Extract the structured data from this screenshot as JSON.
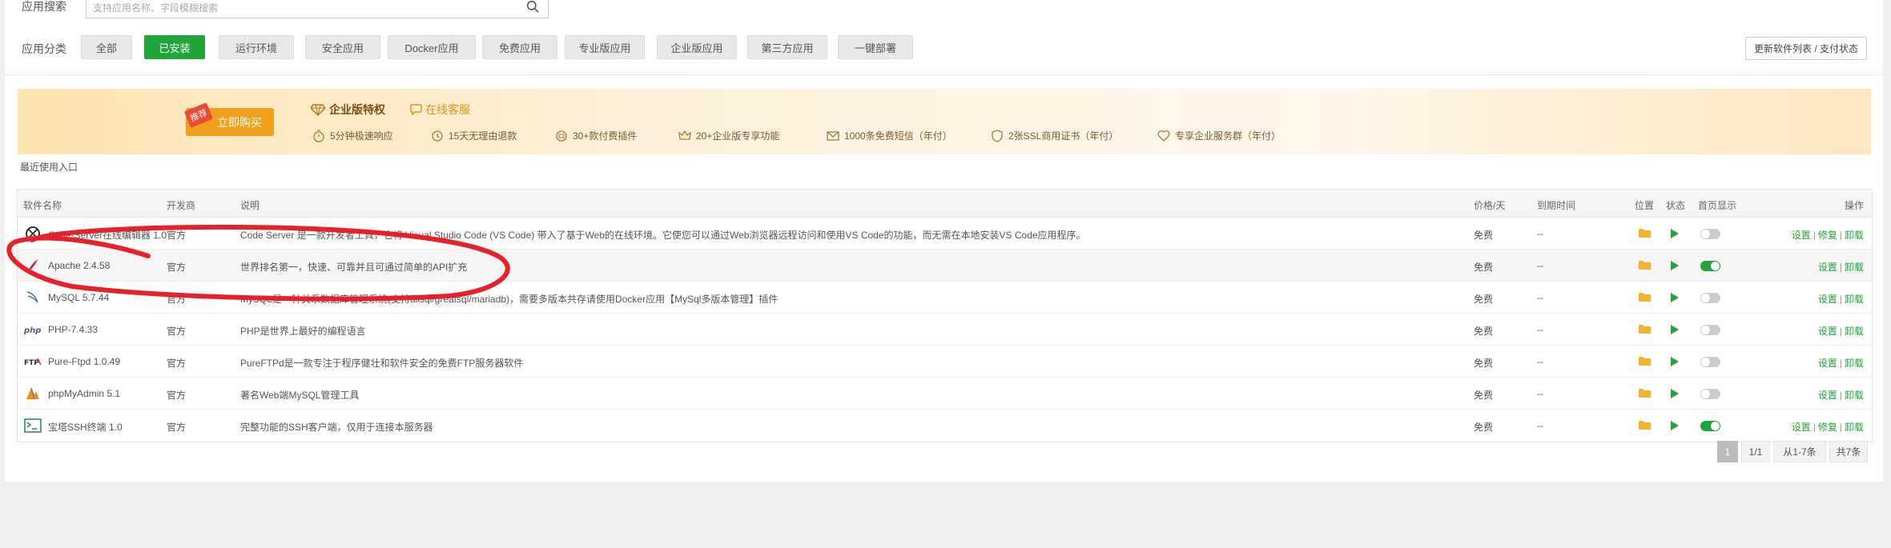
{
  "search": {
    "label": "应用搜索",
    "placeholder": "支持应用名称、字段模糊搜索",
    "icon": "search-icon"
  },
  "categories": {
    "label": "应用分类",
    "items": [
      {
        "label": "全部",
        "active": false
      },
      {
        "label": "已安装",
        "active": true
      },
      {
        "label": "运行环境",
        "active": false
      },
      {
        "label": "安全应用",
        "active": false
      },
      {
        "label": "Docker应用",
        "active": false
      },
      {
        "label": "免费应用",
        "active": false
      },
      {
        "label": "专业版应用",
        "active": false
      },
      {
        "label": "企业版应用",
        "active": false
      },
      {
        "label": "第三方应用",
        "active": false
      },
      {
        "label": "一键部署",
        "active": false
      }
    ],
    "update_button": "更新软件列表 / 支付状态"
  },
  "banner": {
    "tag": "推荐",
    "buy_button": "立即购买",
    "title": "企业版特权",
    "service": "在线客服",
    "perks": [
      "5分钟极速响应",
      "15天无理由退款",
      "30+款付费插件",
      "20+企业版专享功能",
      "1000条免费短信（年付）",
      "2张SSL商用证书（年付）",
      "专享企业服务群（年付）"
    ]
  },
  "recent_label": "最近使用入口",
  "table": {
    "headers": {
      "name": "软件名称",
      "developer": "开发商",
      "description": "说明",
      "price": "价格/天",
      "expiry": "到期时间",
      "location": "位置",
      "status": "状态",
      "homepage": "首页显示",
      "actions": "操作"
    },
    "rows": [
      {
        "name": "Code-Server在线编辑器 1.0",
        "developer": "官方",
        "description": "Code Server 是一款开发者工具，它将 Visual Studio Code (VS Code) 带入了基于Web的在线环境。它使您可以通过Web浏览器远程访问和使用VS Code的功能，而无需在本地安装VS Code应用程序。",
        "price": "免费",
        "expiry": "--",
        "home": false,
        "ops": [
          "设置",
          "修复",
          "卸载"
        ],
        "icon": "code-server-icon"
      },
      {
        "name": "Apache 2.4.58",
        "developer": "官方",
        "description": "世界排名第一，快速、可靠并且可通过简单的API扩充",
        "price": "免费",
        "expiry": "--",
        "home": true,
        "ops": [
          "设置",
          "卸载"
        ],
        "icon": "apache-feather-icon"
      },
      {
        "name": "MySQL 5.7.44",
        "developer": "官方",
        "description": "MySQL是一种关系数据库管理系统(支持alisql/greatsql/mariadb)，需要多版本共存请使用Docker应用【MySql多版本管理】插件",
        "price": "免费",
        "expiry": "--",
        "home": false,
        "ops": [
          "设置",
          "卸载"
        ],
        "icon": "mysql-dolphin-icon"
      },
      {
        "name": "PHP-7.4.33",
        "developer": "官方",
        "description": "PHP是世界上最好的编程语言",
        "price": "免费",
        "expiry": "--",
        "home": false,
        "ops": [
          "设置",
          "卸载"
        ],
        "icon": "php-icon"
      },
      {
        "name": "Pure-Ftpd 1.0.49",
        "developer": "官方",
        "description": "PureFTPd是一款专注于程序健壮和软件安全的免费FTP服务器软件",
        "price": "免费",
        "expiry": "--",
        "home": false,
        "ops": [
          "设置",
          "卸载"
        ],
        "icon": "ftp-icon"
      },
      {
        "name": "phpMyAdmin 5.1",
        "developer": "官方",
        "description": "著名Web端MySQL管理工具",
        "price": "免费",
        "expiry": "--",
        "home": false,
        "ops": [
          "设置",
          "卸载"
        ],
        "icon": "phpmyadmin-icon"
      },
      {
        "name": "宝塔SSH终端 1.0",
        "developer": "官方",
        "description": "完整功能的SSH客户端，仅用于连接本服务器",
        "price": "免费",
        "expiry": "--",
        "home": true,
        "ops": [
          "设置",
          "修复",
          "卸载"
        ],
        "icon": "terminal-icon"
      }
    ]
  },
  "pagination": {
    "current": "1",
    "pages": "1/1",
    "range": "从1-7条",
    "total": "共7条"
  },
  "colors": {
    "accent": "#20a53a",
    "buy": "#f0a01a",
    "annotation": "#e8202a"
  }
}
